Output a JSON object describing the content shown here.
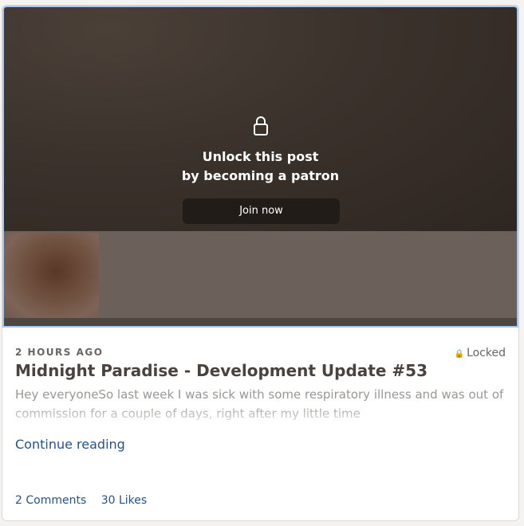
{
  "overlay": {
    "unlock_line1": "Unlock this post",
    "unlock_line2": "by becoming a patron",
    "join_label": "Join now",
    "lock_icon": "lock-icon"
  },
  "post": {
    "timestamp": "2 HOURS AGO",
    "status_icon": "small-lock-icon",
    "status_label": "Locked",
    "title": "Midnight Paradise - Development Update #53",
    "excerpt": "Hey everyoneSo last week I was sick with some respiratory illness and was out of commission for a couple of days, right after my little time",
    "continue_label": "Continue reading"
  },
  "stats": {
    "comments_label": "2 Comments",
    "likes_label": "30 Likes"
  },
  "colors": {
    "link": "#27528a",
    "hero_bg": "#3b322c",
    "focus_border": "#a9c6ec"
  }
}
